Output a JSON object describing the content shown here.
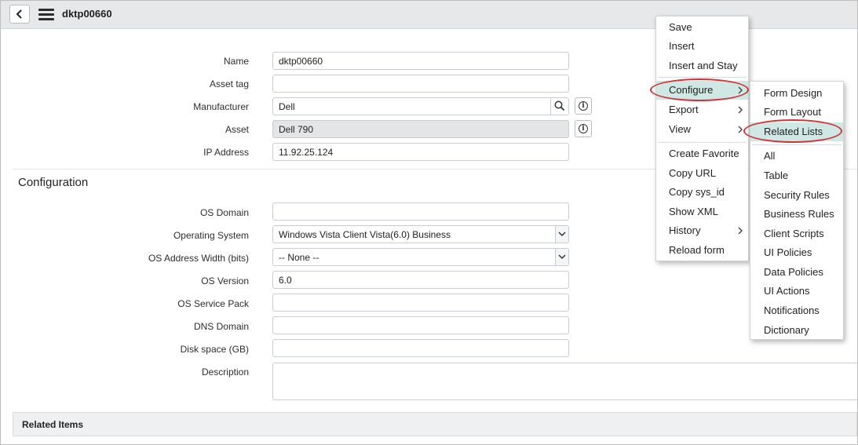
{
  "header": {
    "title": "dktp00660",
    "back_icon": "chevron-left-icon",
    "menu_icon": "hamburger-icon"
  },
  "form": {
    "name": {
      "label": "Name",
      "value": "dktp00660"
    },
    "asset_tag": {
      "label": "Asset tag",
      "value": ""
    },
    "manufacturer": {
      "label": "Manufacturer",
      "value": "Dell"
    },
    "asset": {
      "label": "Asset",
      "value": "Dell 790"
    },
    "ip_address": {
      "label": "IP Address",
      "value": "11.92.25.124"
    }
  },
  "configuration": {
    "title": "Configuration",
    "os_domain": {
      "label": "OS Domain",
      "value": ""
    },
    "operating_system": {
      "label": "Operating System",
      "value": "Windows Vista Client Vista(6.0) Business"
    },
    "os_address_width": {
      "label": "OS Address Width (bits)",
      "value": "-- None --"
    },
    "os_version": {
      "label": "OS Version",
      "value": "6.0"
    },
    "os_service_pack": {
      "label": "OS Service Pack",
      "value": ""
    },
    "dns_domain": {
      "label": "DNS Domain",
      "value": ""
    },
    "disk_space": {
      "label": "Disk space (GB)",
      "value": ""
    },
    "description": {
      "label": "Description",
      "value": ""
    }
  },
  "related_items": {
    "title": "Related Items"
  },
  "context_menu": {
    "items": [
      {
        "label": "Save"
      },
      {
        "label": "Insert"
      },
      {
        "label": "Insert and Stay"
      },
      {
        "label": "Configure",
        "has_submenu": true,
        "active": true
      },
      {
        "label": "Export",
        "has_submenu": true
      },
      {
        "label": "View",
        "has_submenu": true
      },
      {
        "label": "Create Favorite"
      },
      {
        "label": "Copy URL"
      },
      {
        "label": "Copy sys_id"
      },
      {
        "label": "Show XML"
      },
      {
        "label": "History",
        "has_submenu": true
      },
      {
        "label": "Reload form"
      }
    ]
  },
  "configure_submenu": {
    "items": [
      {
        "label": "Form Design"
      },
      {
        "label": "Form Layout"
      },
      {
        "label": "Related Lists",
        "active": true
      },
      {
        "label": "All"
      },
      {
        "label": "Table"
      },
      {
        "label": "Security Rules"
      },
      {
        "label": "Business Rules"
      },
      {
        "label": "Client Scripts"
      },
      {
        "label": "UI Policies"
      },
      {
        "label": "Data Policies"
      },
      {
        "label": "UI Actions"
      },
      {
        "label": "Notifications"
      },
      {
        "label": "Dictionary"
      }
    ]
  },
  "colors": {
    "header_bg": "#e6e8ea",
    "active_item_bg": "#cfe8e3",
    "highlight_ring": "#d0343a"
  }
}
